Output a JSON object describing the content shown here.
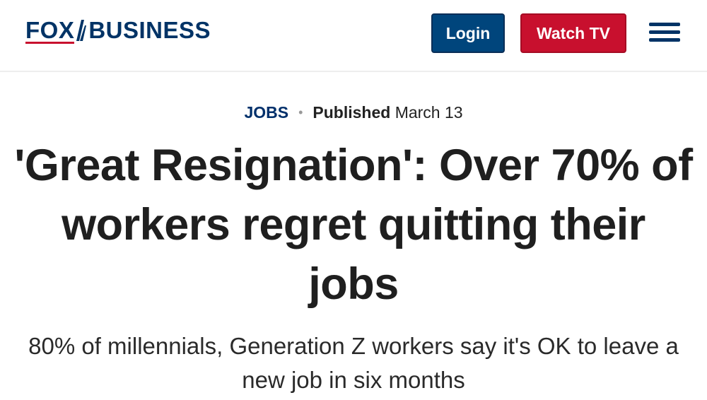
{
  "header": {
    "logo": {
      "part1": "FOX",
      "part2": "BUSINESS"
    },
    "login_label": "Login",
    "watch_tv_label": "Watch TV",
    "menu_icon": "hamburger-menu-icon"
  },
  "article": {
    "category": "JOBS",
    "separator": "•",
    "published_label": "Published",
    "published_date": "March 13",
    "headline": "'Great Resignation': Over 70% of workers regret quitting their jobs",
    "subheadline": "80% of millennials, Generation Z workers say it's OK to leave a new job in six months"
  },
  "colors": {
    "brand_navy": "#003366",
    "login_blue": "#00457c",
    "watch_red": "#c8102e",
    "headline_text": "#1f1f1f"
  }
}
